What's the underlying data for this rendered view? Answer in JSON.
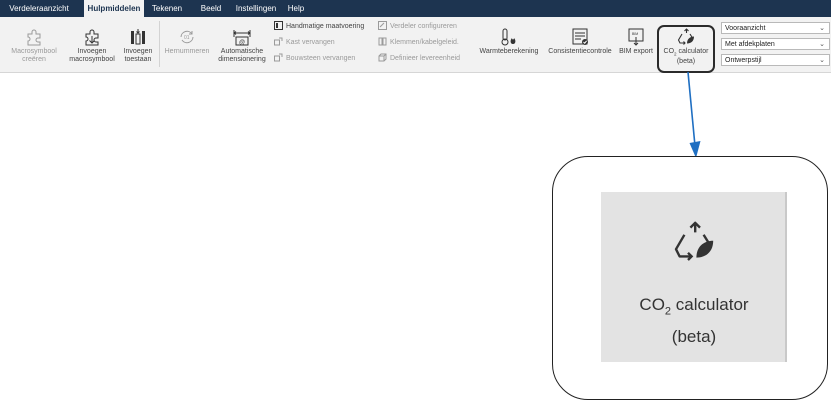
{
  "tabs": [
    {
      "label": "Verdeleraanzicht",
      "active": false
    },
    {
      "label": "Hulpmiddelen",
      "active": true
    },
    {
      "label": "Tekenen",
      "active": false
    },
    {
      "label": "Beeld",
      "active": false
    },
    {
      "label": "Instellingen",
      "active": false
    },
    {
      "label": "Help",
      "active": false
    }
  ],
  "ribbon": {
    "macro_create": "Macrosymbool creëren",
    "insert_macro": "Invoegen macrosymbool",
    "insert_allow": "Invoegen toestaan",
    "renumber": "Hernummeren",
    "auto_dimension": "Automatische dimensionering",
    "manual_dimension": "Handmatige maatvoering",
    "replace_cabinet": "Kast vervangen",
    "replace_block": "Bouwsteen vervangen",
    "configure_distributor": "Verdeler configureren",
    "terminals_cable": "Klemmen/kabelgeleid.",
    "define_delivery_unit": "Definieer levereenheid",
    "heat_calc": "Warmteberekening",
    "consistency": "Consistentiecontrole",
    "bim_export": "BIM export",
    "co2_prefix": "CO",
    "co2_sub": "2",
    "co2_suffix": " calculator",
    "co2_beta": "(beta)"
  },
  "dropdowns": {
    "view": "Vooraanzicht",
    "plates": "Met afdekplaten",
    "style": "Ontwerpstijl"
  },
  "colors": {
    "tabbar": "#1d3450",
    "ribbon": "#f2f2f2",
    "arrow": "#1f6fc2"
  }
}
